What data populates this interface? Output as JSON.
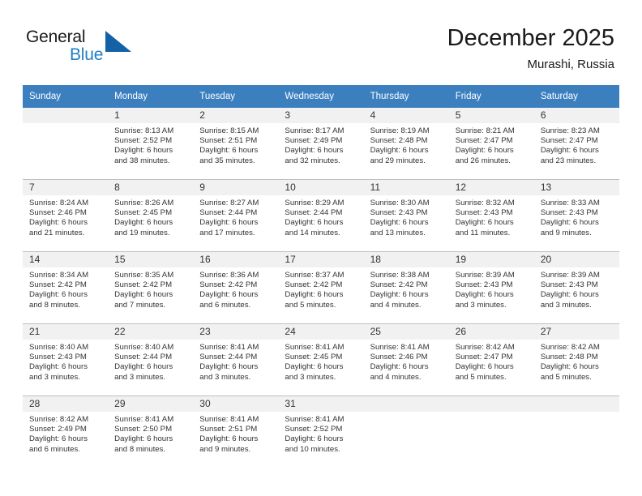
{
  "logo": {
    "word_one": "General",
    "word_two": "Blue",
    "triangle_color": "#1461a8",
    "blue_text_color": "#1f7fc4"
  },
  "header": {
    "title": "December 2025",
    "subtitle": "Murashi, Russia"
  },
  "theme": {
    "header_row_background": "#3c7fbf",
    "header_row_text": "#ffffff",
    "day_band_background": "#f1f1f1",
    "grid_line": "#bfbfbf",
    "body_text": "#333333"
  },
  "weekday_headers": [
    "Sunday",
    "Monday",
    "Tuesday",
    "Wednesday",
    "Thursday",
    "Friday",
    "Saturday"
  ],
  "labels": {
    "sunrise_prefix": "Sunrise: ",
    "sunset_prefix": "Sunset: ",
    "daylight_prefix": "Daylight: "
  },
  "weeks": [
    [
      {
        "empty": true
      },
      {
        "day": "1",
        "sunrise": "Sunrise: 8:13 AM",
        "sunset": "Sunset: 2:52 PM",
        "daylight_1": "Daylight: 6 hours",
        "daylight_2": "and 38 minutes."
      },
      {
        "day": "2",
        "sunrise": "Sunrise: 8:15 AM",
        "sunset": "Sunset: 2:51 PM",
        "daylight_1": "Daylight: 6 hours",
        "daylight_2": "and 35 minutes."
      },
      {
        "day": "3",
        "sunrise": "Sunrise: 8:17 AM",
        "sunset": "Sunset: 2:49 PM",
        "daylight_1": "Daylight: 6 hours",
        "daylight_2": "and 32 minutes."
      },
      {
        "day": "4",
        "sunrise": "Sunrise: 8:19 AM",
        "sunset": "Sunset: 2:48 PM",
        "daylight_1": "Daylight: 6 hours",
        "daylight_2": "and 29 minutes."
      },
      {
        "day": "5",
        "sunrise": "Sunrise: 8:21 AM",
        "sunset": "Sunset: 2:47 PM",
        "daylight_1": "Daylight: 6 hours",
        "daylight_2": "and 26 minutes."
      },
      {
        "day": "6",
        "sunrise": "Sunrise: 8:23 AM",
        "sunset": "Sunset: 2:47 PM",
        "daylight_1": "Daylight: 6 hours",
        "daylight_2": "and 23 minutes."
      }
    ],
    [
      {
        "day": "7",
        "sunrise": "Sunrise: 8:24 AM",
        "sunset": "Sunset: 2:46 PM",
        "daylight_1": "Daylight: 6 hours",
        "daylight_2": "and 21 minutes."
      },
      {
        "day": "8",
        "sunrise": "Sunrise: 8:26 AM",
        "sunset": "Sunset: 2:45 PM",
        "daylight_1": "Daylight: 6 hours",
        "daylight_2": "and 19 minutes."
      },
      {
        "day": "9",
        "sunrise": "Sunrise: 8:27 AM",
        "sunset": "Sunset: 2:44 PM",
        "daylight_1": "Daylight: 6 hours",
        "daylight_2": "and 17 minutes."
      },
      {
        "day": "10",
        "sunrise": "Sunrise: 8:29 AM",
        "sunset": "Sunset: 2:44 PM",
        "daylight_1": "Daylight: 6 hours",
        "daylight_2": "and 14 minutes."
      },
      {
        "day": "11",
        "sunrise": "Sunrise: 8:30 AM",
        "sunset": "Sunset: 2:43 PM",
        "daylight_1": "Daylight: 6 hours",
        "daylight_2": "and 13 minutes."
      },
      {
        "day": "12",
        "sunrise": "Sunrise: 8:32 AM",
        "sunset": "Sunset: 2:43 PM",
        "daylight_1": "Daylight: 6 hours",
        "daylight_2": "and 11 minutes."
      },
      {
        "day": "13",
        "sunrise": "Sunrise: 8:33 AM",
        "sunset": "Sunset: 2:43 PM",
        "daylight_1": "Daylight: 6 hours",
        "daylight_2": "and 9 minutes."
      }
    ],
    [
      {
        "day": "14",
        "sunrise": "Sunrise: 8:34 AM",
        "sunset": "Sunset: 2:42 PM",
        "daylight_1": "Daylight: 6 hours",
        "daylight_2": "and 8 minutes."
      },
      {
        "day": "15",
        "sunrise": "Sunrise: 8:35 AM",
        "sunset": "Sunset: 2:42 PM",
        "daylight_1": "Daylight: 6 hours",
        "daylight_2": "and 7 minutes."
      },
      {
        "day": "16",
        "sunrise": "Sunrise: 8:36 AM",
        "sunset": "Sunset: 2:42 PM",
        "daylight_1": "Daylight: 6 hours",
        "daylight_2": "and 6 minutes."
      },
      {
        "day": "17",
        "sunrise": "Sunrise: 8:37 AM",
        "sunset": "Sunset: 2:42 PM",
        "daylight_1": "Daylight: 6 hours",
        "daylight_2": "and 5 minutes."
      },
      {
        "day": "18",
        "sunrise": "Sunrise: 8:38 AM",
        "sunset": "Sunset: 2:42 PM",
        "daylight_1": "Daylight: 6 hours",
        "daylight_2": "and 4 minutes."
      },
      {
        "day": "19",
        "sunrise": "Sunrise: 8:39 AM",
        "sunset": "Sunset: 2:43 PM",
        "daylight_1": "Daylight: 6 hours",
        "daylight_2": "and 3 minutes."
      },
      {
        "day": "20",
        "sunrise": "Sunrise: 8:39 AM",
        "sunset": "Sunset: 2:43 PM",
        "daylight_1": "Daylight: 6 hours",
        "daylight_2": "and 3 minutes."
      }
    ],
    [
      {
        "day": "21",
        "sunrise": "Sunrise: 8:40 AM",
        "sunset": "Sunset: 2:43 PM",
        "daylight_1": "Daylight: 6 hours",
        "daylight_2": "and 3 minutes."
      },
      {
        "day": "22",
        "sunrise": "Sunrise: 8:40 AM",
        "sunset": "Sunset: 2:44 PM",
        "daylight_1": "Daylight: 6 hours",
        "daylight_2": "and 3 minutes."
      },
      {
        "day": "23",
        "sunrise": "Sunrise: 8:41 AM",
        "sunset": "Sunset: 2:44 PM",
        "daylight_1": "Daylight: 6 hours",
        "daylight_2": "and 3 minutes."
      },
      {
        "day": "24",
        "sunrise": "Sunrise: 8:41 AM",
        "sunset": "Sunset: 2:45 PM",
        "daylight_1": "Daylight: 6 hours",
        "daylight_2": "and 3 minutes."
      },
      {
        "day": "25",
        "sunrise": "Sunrise: 8:41 AM",
        "sunset": "Sunset: 2:46 PM",
        "daylight_1": "Daylight: 6 hours",
        "daylight_2": "and 4 minutes."
      },
      {
        "day": "26",
        "sunrise": "Sunrise: 8:42 AM",
        "sunset": "Sunset: 2:47 PM",
        "daylight_1": "Daylight: 6 hours",
        "daylight_2": "and 5 minutes."
      },
      {
        "day": "27",
        "sunrise": "Sunrise: 8:42 AM",
        "sunset": "Sunset: 2:48 PM",
        "daylight_1": "Daylight: 6 hours",
        "daylight_2": "and 5 minutes."
      }
    ],
    [
      {
        "day": "28",
        "sunrise": "Sunrise: 8:42 AM",
        "sunset": "Sunset: 2:49 PM",
        "daylight_1": "Daylight: 6 hours",
        "daylight_2": "and 6 minutes."
      },
      {
        "day": "29",
        "sunrise": "Sunrise: 8:41 AM",
        "sunset": "Sunset: 2:50 PM",
        "daylight_1": "Daylight: 6 hours",
        "daylight_2": "and 8 minutes."
      },
      {
        "day": "30",
        "sunrise": "Sunrise: 8:41 AM",
        "sunset": "Sunset: 2:51 PM",
        "daylight_1": "Daylight: 6 hours",
        "daylight_2": "and 9 minutes."
      },
      {
        "day": "31",
        "sunrise": "Sunrise: 8:41 AM",
        "sunset": "Sunset: 2:52 PM",
        "daylight_1": "Daylight: 6 hours",
        "daylight_2": "and 10 minutes."
      },
      {
        "empty": true
      },
      {
        "empty": true
      },
      {
        "empty": true
      }
    ]
  ]
}
